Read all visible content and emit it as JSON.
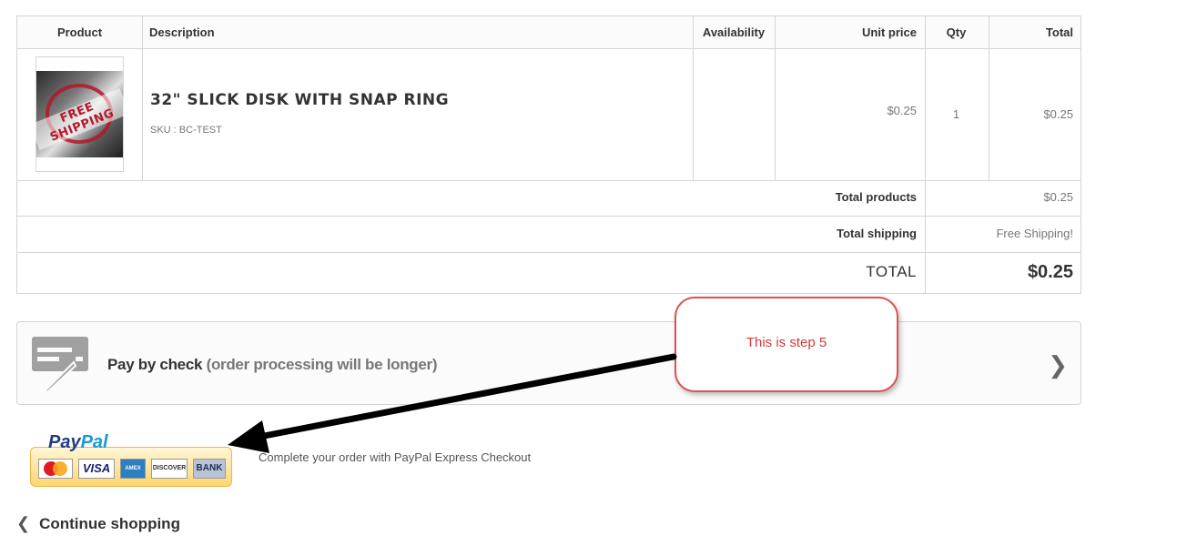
{
  "table": {
    "headers": [
      "Product",
      "Description",
      "Availability",
      "Unit price",
      "Qty",
      "Total"
    ],
    "product": {
      "image_text": "FREE SHIPPING",
      "name": "32\" SLICK DISK WITH SNAP RING",
      "sku": "SKU : BC-TEST",
      "availability": "",
      "unit_price": "$0.25",
      "qty": "1",
      "total": "$0.25"
    },
    "total_products_label": "Total products",
    "total_products_value": "$0.25",
    "total_shipping_label": "Total shipping",
    "total_shipping_value": "Free Shipping!",
    "total_label": "TOTAL",
    "total_value": "$0.25"
  },
  "payment": {
    "check_label": "Pay by check",
    "check_note": "(order processing will be longer)",
    "paypal_desc": "Complete your order with PayPal Express Checkout",
    "paypal_word_1": "Pay",
    "paypal_word_2": "Pal",
    "cards": [
      "MasterCard",
      "VISA",
      "AMEX",
      "DISCOVER",
      "BANK"
    ]
  },
  "callout": {
    "text": "This is step 5"
  },
  "continue_label": "Continue shopping",
  "colors": {
    "callout_border": "#d9534f",
    "callout_text": "#d73a3a"
  }
}
